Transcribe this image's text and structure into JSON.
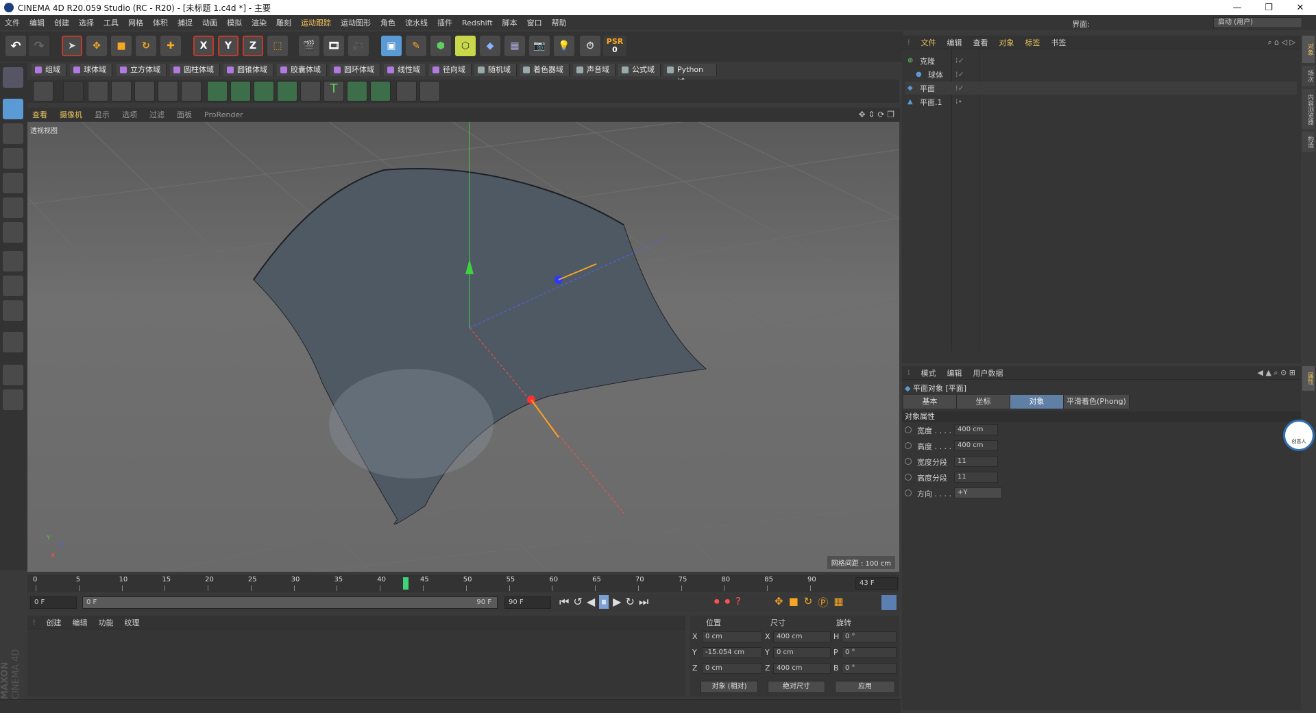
{
  "window": {
    "title": "CINEMA 4D R20.059 Studio (RC - R20) - [未标题 1.c4d *] - 主要",
    "minimize": "—",
    "restore": "❐",
    "close": "✕"
  },
  "menu": [
    "文件",
    "编辑",
    "创建",
    "选择",
    "工具",
    "网格",
    "体积",
    "捕捉",
    "动画",
    "模拟",
    "渲染",
    "雕刻",
    "运动跟踪",
    "运动图形",
    "角色",
    "流水线",
    "插件",
    "Redshift",
    "脚本",
    "窗口",
    "帮助"
  ],
  "layout": {
    "label": "界面:",
    "value": "启动 (用户)"
  },
  "toolbar": {
    "psr_label": "PSR",
    "psr_value": "0",
    "axis_x": "X",
    "axis_y": "Y",
    "axis_z": "Z"
  },
  "fields_bar": [
    "组域",
    "球体域",
    "立方体域",
    "圆柱体域",
    "圆锥体域",
    "胶囊体域",
    "圆环体域",
    "线性域",
    "径向域",
    "随机域",
    "着色器域",
    "声音域",
    "公式域",
    "Python域"
  ],
  "viewport": {
    "menu": [
      "查看",
      "摄像机",
      "显示",
      "选项",
      "过滤",
      "面板",
      "ProRender"
    ],
    "name": "透视视图",
    "grid_spacing": "网格间距 : 100 cm",
    "axis_labels": {
      "x": "X",
      "y": "Y",
      "z": "Z"
    }
  },
  "timeline": {
    "ticks": [
      "0",
      "5",
      "10",
      "15",
      "20",
      "25",
      "30",
      "35",
      "40",
      "45",
      "50",
      "55",
      "60",
      "65",
      "70",
      "75",
      "80",
      "85",
      "90"
    ],
    "current_frame": "43 F",
    "current_frame_value": 43,
    "max_frame": 90,
    "start": "0 F",
    "range_start": "0 F",
    "range_end": "90 F",
    "end": "90 F"
  },
  "material_manager": {
    "menu": [
      "创建",
      "编辑",
      "功能",
      "纹理"
    ]
  },
  "brand": {
    "maxon": "MAXON",
    "c4d": "CINEMA 4D"
  },
  "coordinates": {
    "headers": [
      "位置",
      "尺寸",
      "旋转"
    ],
    "rows": [
      {
        "a": "X",
        "pos": "0 cm",
        "b": "X",
        "size": "400 cm",
        "c": "H",
        "rot": "0 °"
      },
      {
        "a": "Y",
        "pos": "-15.054 cm",
        "b": "Y",
        "size": "0 cm",
        "c": "P",
        "rot": "0 °"
      },
      {
        "a": "Z",
        "pos": "0 cm",
        "b": "Z",
        "size": "400 cm",
        "c": "B",
        "rot": "0 °"
      }
    ],
    "mode": "对象 (相对)",
    "size_mode": "绝对尺寸",
    "apply": "应用"
  },
  "object_manager": {
    "menu": [
      "文件",
      "编辑",
      "查看",
      "对象",
      "标签",
      "书签"
    ],
    "objects": [
      {
        "name": "克隆",
        "color": "#ff8a8a"
      },
      {
        "name": "球体",
        "color": "#cfcfcf"
      },
      {
        "name": "平面",
        "color": "#f2b84a"
      },
      {
        "name": "平面.1",
        "color": "#cfcfcf"
      }
    ]
  },
  "attributes": {
    "menu": [
      "模式",
      "编辑",
      "用户数据"
    ],
    "title": "平面对象 [平面]",
    "tabs": [
      "基本",
      "坐标",
      "对象",
      "平滑着色(Phong)"
    ],
    "active_tab": "对象",
    "section": "对象属性",
    "props": [
      {
        "label": "宽度 . . . .",
        "value": "400 cm"
      },
      {
        "label": "高度 . . . .",
        "value": "400 cm"
      },
      {
        "label": "宽度分段",
        "value": "11"
      },
      {
        "label": "高度分段",
        "value": "11"
      },
      {
        "label": "方向 . . . .",
        "value": "+Y"
      }
    ]
  },
  "side_tabs": [
    "对象",
    "场次",
    "内容浏览器",
    "构造",
    "属性"
  ],
  "badge": "创意人"
}
